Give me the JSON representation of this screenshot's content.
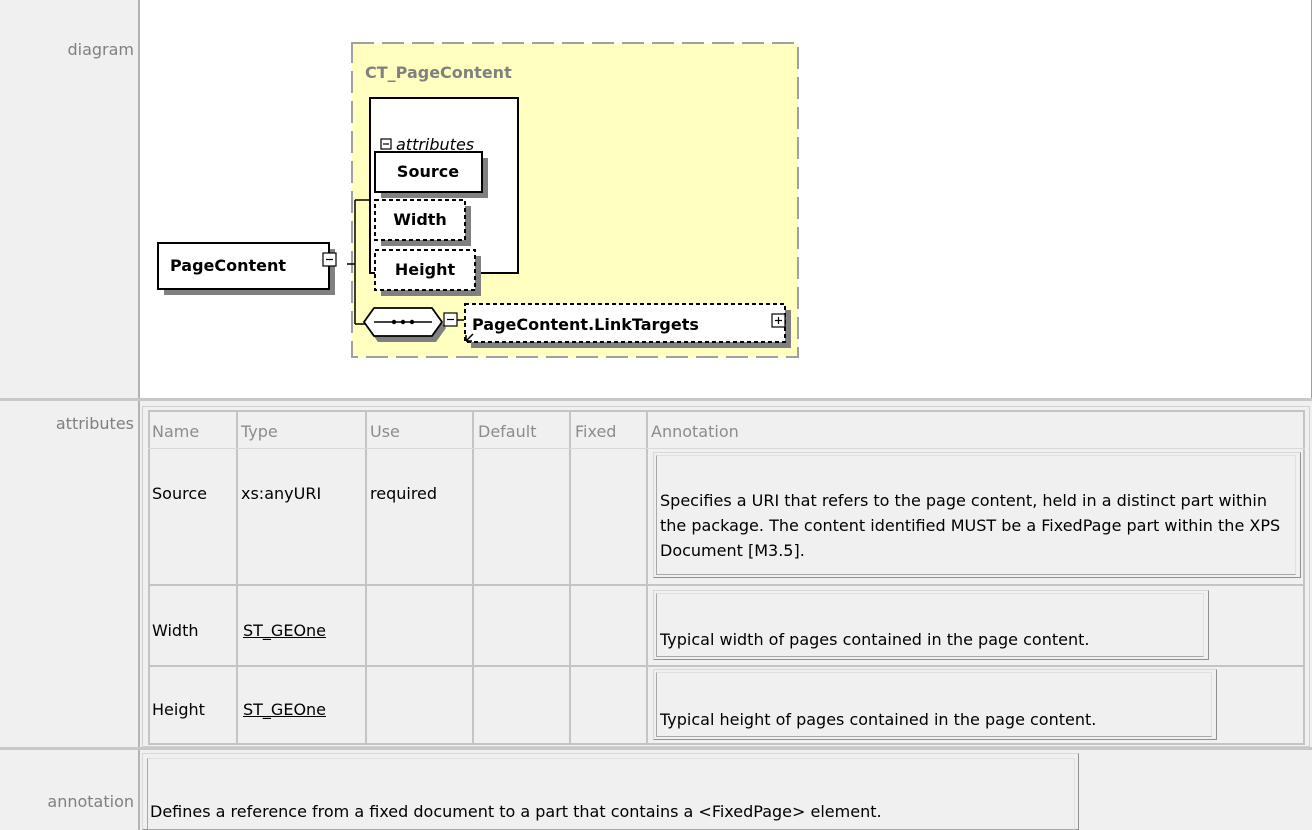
{
  "rows": {
    "diagram_label": "diagram",
    "attributes_label": "attributes",
    "annotation_label": "annotation"
  },
  "diagram": {
    "complex_type": "CT_PageContent",
    "attributes_group": "attributes",
    "attrs": [
      "Source",
      "Width",
      "Height"
    ],
    "element": "PageContent",
    "child_element": "PageContent.LinkTargets",
    "colors": {
      "type_fill": "#ffffc0",
      "type_border": "#a0a0a0",
      "type_label": "#808080"
    }
  },
  "attributes_table": {
    "headers": [
      "Name",
      "Type",
      "Use",
      "Default",
      "Fixed",
      "Annotation"
    ],
    "rows": [
      {
        "name": "Source",
        "type": "xs:anyURI",
        "use": "required",
        "default": "",
        "fixed": "",
        "annotation": "Specifies a URI that refers to the page content, held in a distinct part within the package. The content identified MUST be a FixedPage part within the XPS Document [M3.5]."
      },
      {
        "name": "Width",
        "type": "ST_GEOne",
        "use": "",
        "default": "",
        "fixed": "",
        "annotation": "Typical width of pages contained in the page content."
      },
      {
        "name": "Height",
        "type": "ST_GEOne",
        "use": "",
        "default": "",
        "fixed": "",
        "annotation": "Typical height of pages contained in the page content."
      }
    ]
  },
  "annotation": {
    "text": "Defines a reference from a fixed document to a part that contains a <FixedPage> element."
  }
}
